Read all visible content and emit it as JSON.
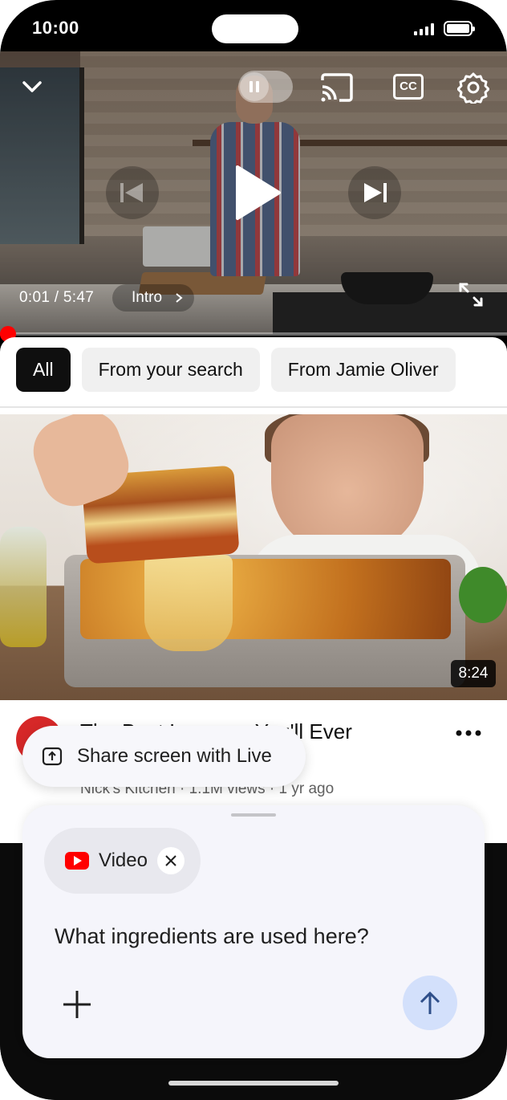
{
  "status_bar": {
    "time": "10:00"
  },
  "player": {
    "time_readout": "0:01 / 5:47",
    "chapter": "Intro",
    "cc_label": "CC",
    "progress": 0.003
  },
  "filters": {
    "chips": [
      {
        "label": "All",
        "active": true
      },
      {
        "label": "From your search",
        "active": false
      },
      {
        "label": "From Jamie Oliver",
        "active": false
      }
    ]
  },
  "video": {
    "duration": "8:24",
    "title": "The Best Lasagna You'll Ever",
    "channel_line": "Nick's Kitchen · 1.1M views · 1 yr ago"
  },
  "share_live": {
    "label": "Share screen with Live"
  },
  "assistant": {
    "attachment_label": "Video",
    "prompt": "What ingredients are used here?"
  },
  "colors": {
    "accent_red": "#ff0000",
    "chip_active_bg": "#0f0f0f",
    "send_button_bg": "#d3e0fb",
    "assistant_bg": "#f5f5fb"
  },
  "icons": [
    "collapse-icon",
    "pause-icon",
    "cast-icon",
    "cc-icon",
    "gear-icon",
    "previous-icon",
    "play-icon",
    "next-icon",
    "fullscreen-icon",
    "more-icon",
    "share-icon",
    "youtube-icon",
    "close-icon",
    "plus-icon",
    "arrow-up-icon"
  ]
}
